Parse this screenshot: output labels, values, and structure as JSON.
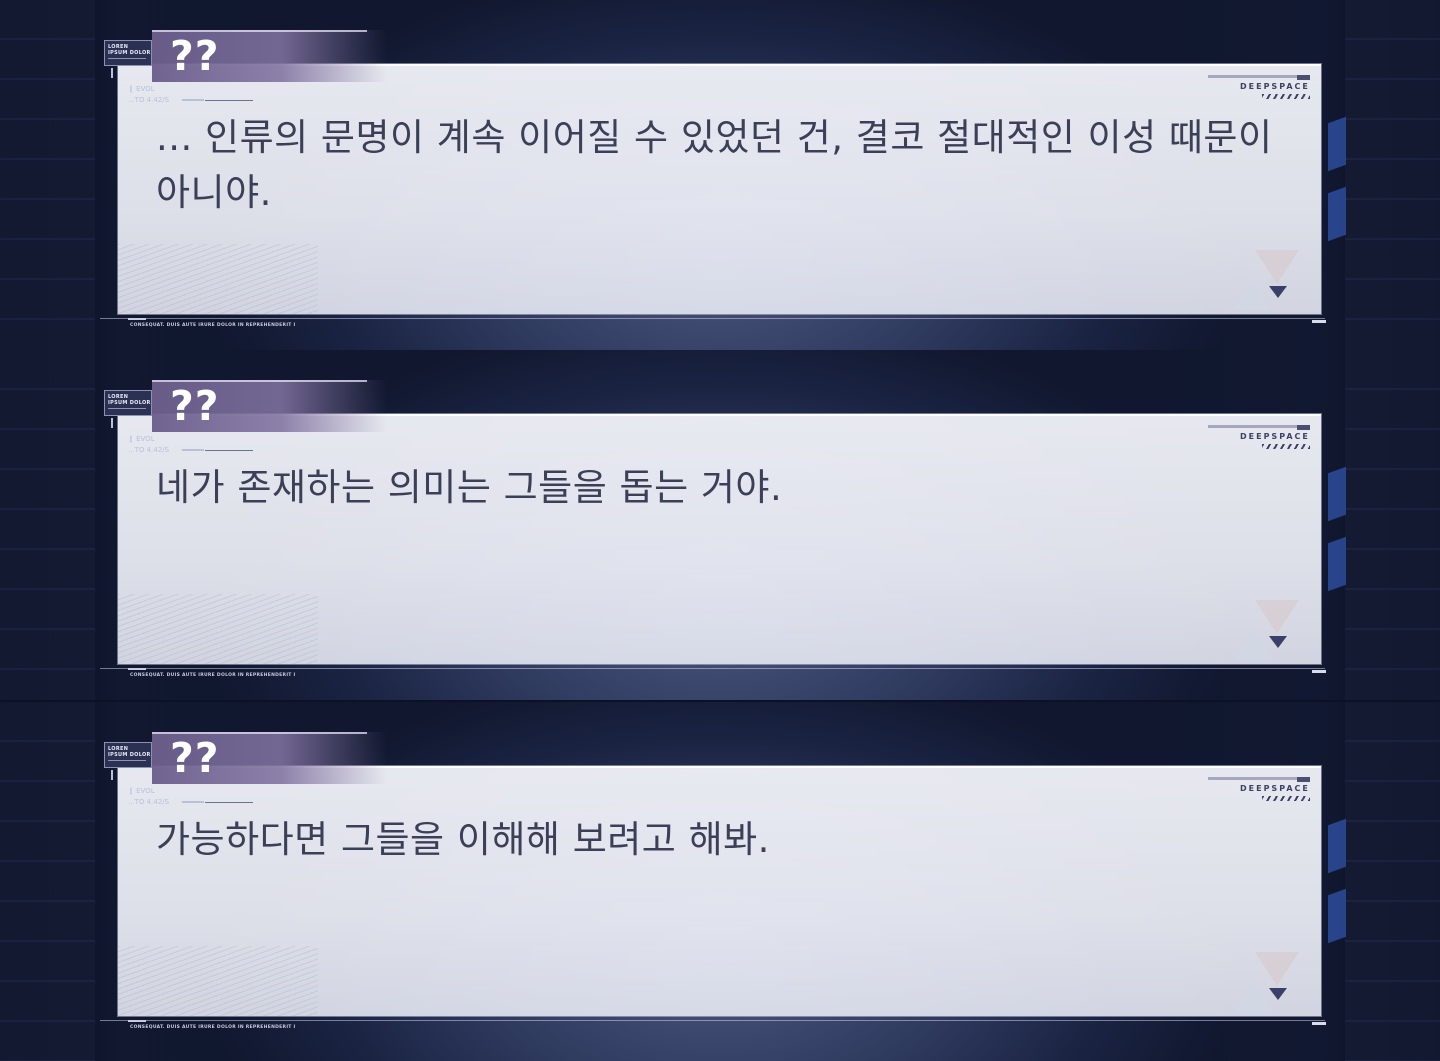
{
  "panels": [
    {
      "speaker": "??",
      "text": "... 인류의 문명이 계속 이어질 수 있었던 건, 결코 절대적인 이성 때문이 아니야.",
      "logo": {
        "line1": "LOREN",
        "line2": "IPSUM DOLOR"
      },
      "evol": {
        "label": "EVOL",
        "value": "...TO 4.42/S"
      },
      "brand": "DEEPSPACE",
      "footer": "CONSEQUAT. DUIS AUTE IRURE DOLOR IN REPREHENDERIT I"
    },
    {
      "speaker": "??",
      "text": "네가 존재하는 의미는 그들을 돕는 거야.",
      "logo": {
        "line1": "LOREN",
        "line2": "IPSUM DOLOR"
      },
      "evol": {
        "label": "EVOL",
        "value": "...TO 4.42/S"
      },
      "brand": "DEEPSPACE",
      "footer": "CONSEQUAT. DUIS AUTE IRURE DOLOR IN REPREHENDERIT I"
    },
    {
      "speaker": "??",
      "text": "가능하다면 그들을 이해해 보려고 해봐.",
      "logo": {
        "line1": "LOREN",
        "line2": "IPSUM DOLOR"
      },
      "evol": {
        "label": "EVOL",
        "value": "...TO 4.42/S"
      },
      "brand": "DEEPSPACE",
      "footer": "CONSEQUAT. DUIS AUTE IRURE DOLOR IN REPREHENDERIT I"
    }
  ],
  "icons": {
    "advance": "advance-arrow-icon",
    "deco": "triangle-deco-icon"
  },
  "colors": {
    "namebar": "#6c5e8c",
    "dialogue_text": "#3b3f57",
    "box": "#f2f3f9",
    "accent_stripe": "#3d69d8"
  }
}
